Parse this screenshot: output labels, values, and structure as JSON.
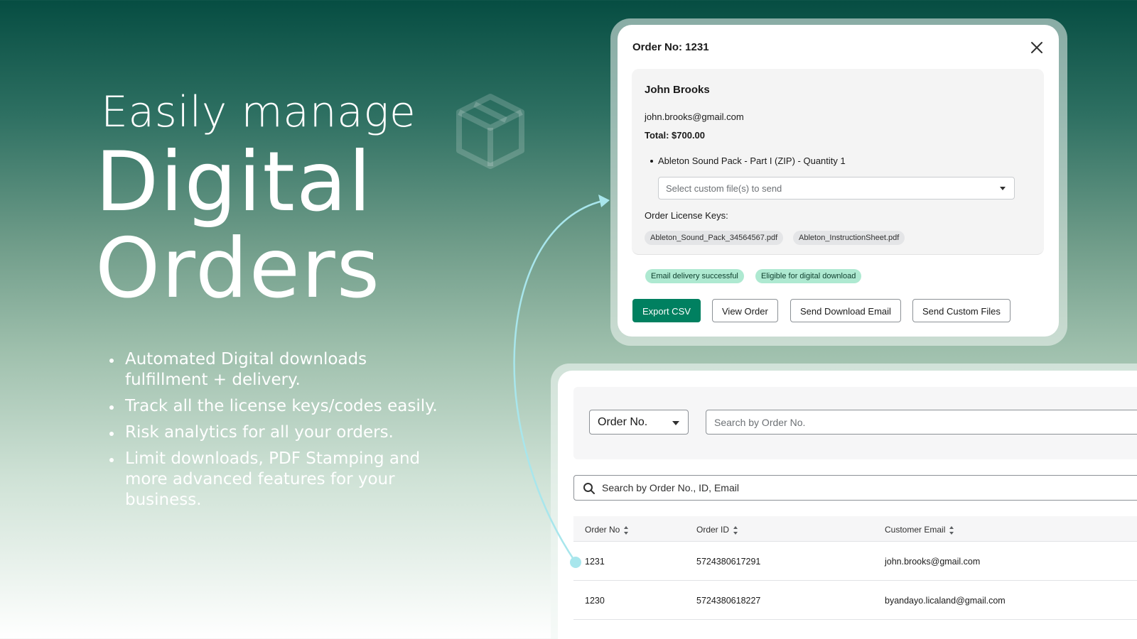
{
  "hero": {
    "subtitle": "Easily manage",
    "title_line1": "Digital",
    "title_line2": "Orders"
  },
  "features": [
    "Automated Digital downloads fulfillment + delivery.",
    "Track all the license keys/codes easily.",
    "Risk analytics for all your orders.",
    "Limit downloads, PDF Stamping and more advanced features for your business."
  ],
  "modal": {
    "title": "Order No: 1231",
    "customer": {
      "name": "John Brooks",
      "email": "john.brooks@gmail.com",
      "total": "Total: $700.00"
    },
    "line_item": "Ableton Sound Pack - Part I (ZIP) - Quantity 1",
    "file_select_placeholder": "Select custom file(s) to send",
    "license_keys_label": "Order License Keys:",
    "license_keys": [
      "Ableton_Sound_Pack_34564567.pdf",
      "Ableton_InstructionSheet.pdf"
    ],
    "badges": [
      "Email delivery successful",
      "Eligible for digital download"
    ],
    "buttons": {
      "export": "Export CSV",
      "view": "View Order",
      "send_email": "Send Download Email",
      "send_files": "Send Custom Files"
    }
  },
  "orders_panel": {
    "filter_select_value": "Order No.",
    "filter_placeholder": "Search by Order No.",
    "search_placeholder": "Search by Order No., ID, Email",
    "columns": [
      "Order No",
      "Order ID",
      "Customer Email"
    ],
    "rows": [
      [
        "1231",
        "5724380617291",
        "john.brooks@gmail.com"
      ],
      [
        "1230",
        "5724380618227",
        "byandayo.licaland@gmail.com"
      ]
    ]
  },
  "colors": {
    "primary_button": "#008060",
    "badge_success": "#aee9d1",
    "connector": "#a8e6ec"
  },
  "icons": {
    "close": "close-icon",
    "search": "search-icon",
    "box": "box-icon",
    "dropdown": "chevron-down-icon",
    "sort": "sort-icon"
  }
}
